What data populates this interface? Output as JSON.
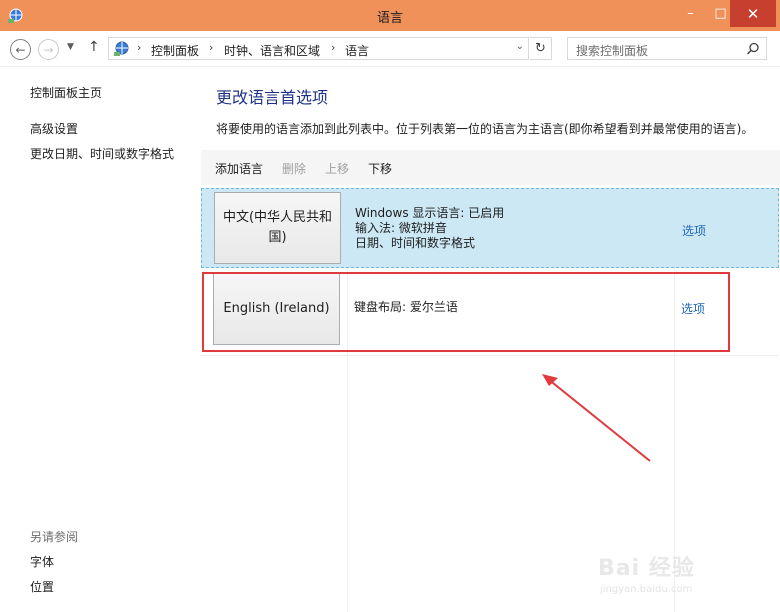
{
  "window": {
    "title": "语言"
  },
  "titlebar_buttons": {
    "minimize": "–",
    "maximize": "□",
    "close": "✕"
  },
  "address": {
    "breadcrumbs": [
      "控制面板",
      "时钟、语言和区域",
      "语言"
    ]
  },
  "search": {
    "placeholder": "搜索控制面板"
  },
  "sidebar": {
    "links": [
      "控制面板主页",
      "高级设置",
      "更改日期、时间或数字格式"
    ],
    "see_also_title": "另请参阅",
    "see_also_links": [
      "字体",
      "位置"
    ]
  },
  "main": {
    "title": "更改语言首选项",
    "description": "将要使用的语言添加到此列表中。位于列表第一位的语言为主语言(即你希望看到并最常使用的语言)。",
    "toolbar": {
      "add": "添加语言",
      "remove": "删除",
      "move_up": "上移",
      "move_down": "下移"
    },
    "languages": [
      {
        "name": "中文(中华人民共和国)",
        "info": [
          "Windows 显示语言: 已启用",
          "输入法: 微软拼音",
          "日期、时间和数字格式"
        ],
        "options": "选项",
        "selected": true
      },
      {
        "name": "English (Ireland)",
        "info": [
          "键盘布局: 爱尔兰语"
        ],
        "options": "选项",
        "selected": false
      }
    ]
  },
  "annotation": {
    "color": "#e0393e"
  },
  "watermark": {
    "logo": "Bai 经验",
    "url": "jingyan.baidu.com"
  }
}
